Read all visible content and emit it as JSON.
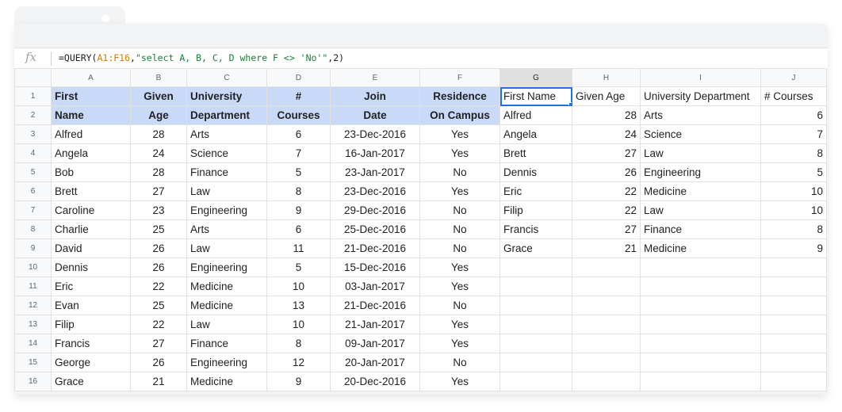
{
  "formula_bar": {
    "fx_label": "fx",
    "formula_prefix": "=QUERY(",
    "formula_range": "A1:F16",
    "formula_comma": ",",
    "formula_string": "\"select A, B, C, D where F <> 'No'\"",
    "formula_suffix": ",2)"
  },
  "columns": [
    "A",
    "B",
    "C",
    "D",
    "E",
    "F",
    "G",
    "H",
    "I",
    "J"
  ],
  "rows": [
    [
      "First",
      "Given",
      "University",
      "#",
      "Join",
      "Residence",
      "First Name",
      "Given Age",
      "University Department",
      "#  Courses"
    ],
    [
      "Name",
      "Age",
      "Department",
      "Courses",
      "Date",
      "On Campus",
      "Alfred",
      "28",
      "Arts",
      "6"
    ],
    [
      "Alfred",
      "28",
      "Arts",
      "6",
      "23-Dec-2016",
      "Yes",
      "Angela",
      "24",
      "Science",
      "7"
    ],
    [
      "Angela",
      "24",
      "Science",
      "7",
      "16-Jan-2017",
      "Yes",
      "Brett",
      "27",
      "Law",
      "8"
    ],
    [
      "Bob",
      "28",
      "Finance",
      "5",
      "23-Jan-2017",
      "No",
      "Dennis",
      "26",
      "Engineering",
      "5"
    ],
    [
      "Brett",
      "27",
      "Law",
      "8",
      "23-Dec-2016",
      "Yes",
      "Eric",
      "22",
      "Medicine",
      "10"
    ],
    [
      "Caroline",
      "23",
      "Engineering",
      "9",
      "29-Dec-2016",
      "No",
      "Filip",
      "22",
      "Law",
      "10"
    ],
    [
      "Charlie",
      "25",
      "Arts",
      "6",
      "25-Dec-2016",
      "No",
      "Francis",
      "27",
      "Finance",
      "8"
    ],
    [
      "David",
      "26",
      "Law",
      "11",
      "21-Dec-2016",
      "No",
      "Grace",
      "21",
      "Medicine",
      "9"
    ],
    [
      "Dennis",
      "26",
      "Engineering",
      "5",
      "15-Dec-2016",
      "Yes",
      "",
      "",
      "",
      ""
    ],
    [
      "Eric",
      "22",
      "Medicine",
      "10",
      "03-Jan-2017",
      "Yes",
      "",
      "",
      "",
      ""
    ],
    [
      "Evan",
      "25",
      "Medicine",
      "13",
      "21-Dec-2016",
      "No",
      "",
      "",
      "",
      ""
    ],
    [
      "Filip",
      "22",
      "Law",
      "10",
      "21-Jan-2017",
      "Yes",
      "",
      "",
      "",
      ""
    ],
    [
      "Francis",
      "27",
      "Finance",
      "8",
      "09-Jan-2017",
      "Yes",
      "",
      "",
      "",
      ""
    ],
    [
      "George",
      "26",
      "Engineering",
      "12",
      "20-Jan-2017",
      "No",
      "",
      "",
      "",
      ""
    ],
    [
      "Grace",
      "21",
      "Medicine",
      "9",
      "20-Dec-2016",
      "Yes",
      "",
      "",
      "",
      ""
    ]
  ],
  "colors": {
    "header_fill": "#c9daf8",
    "selection": "#1a73e8"
  },
  "active_cell": "G1"
}
